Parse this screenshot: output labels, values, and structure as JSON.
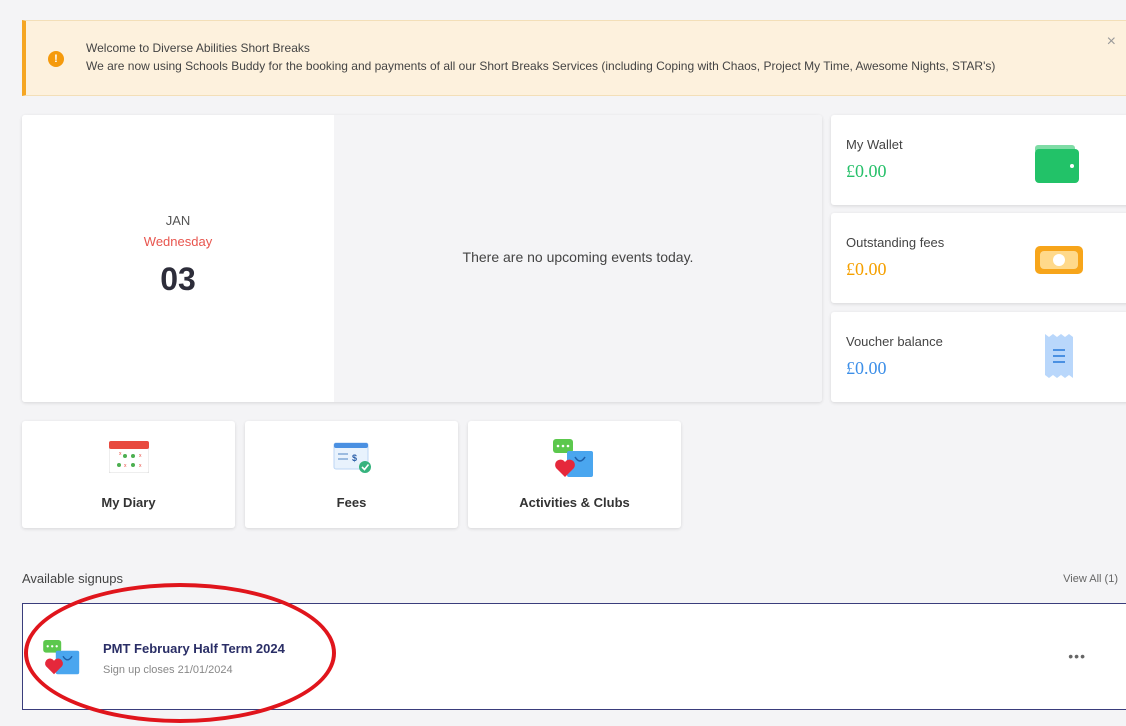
{
  "banner": {
    "title": "Welcome to Diverse Abilities Short Breaks",
    "text": "We are now using Schools Buddy for the booking and payments of all our Short Breaks Services (including Coping with Chaos, Project My Time, Awesome Nights, STAR's)",
    "icon": "!",
    "close": "×"
  },
  "today": {
    "month": "JAN",
    "weekday": "Wednesday",
    "day": "03",
    "empty_message": "There are no upcoming events today."
  },
  "stats": [
    {
      "label": "My Wallet",
      "value": "£0.00",
      "color": "#27c06a",
      "icon": "wallet-icon"
    },
    {
      "label": "Outstanding fees",
      "value": "£0.00",
      "color": "#f5a000",
      "icon": "cash-icon"
    },
    {
      "label": "Voucher balance",
      "value": "£0.00",
      "color": "#3d8fe8",
      "icon": "receipt-icon"
    }
  ],
  "tiles": [
    {
      "label": "My Diary",
      "icon": "calendar-icon"
    },
    {
      "label": "Fees",
      "icon": "invoice-icon"
    },
    {
      "label": "Activities & Clubs",
      "icon": "activities-icon"
    }
  ],
  "signups": {
    "section_title": "Available signups",
    "view_all": "View All (1)",
    "items": [
      {
        "title": "PMT February Half Term 2024",
        "subtitle": "Sign up closes 21/01/2024",
        "more": "•••",
        "icon": "activities-icon"
      }
    ]
  }
}
